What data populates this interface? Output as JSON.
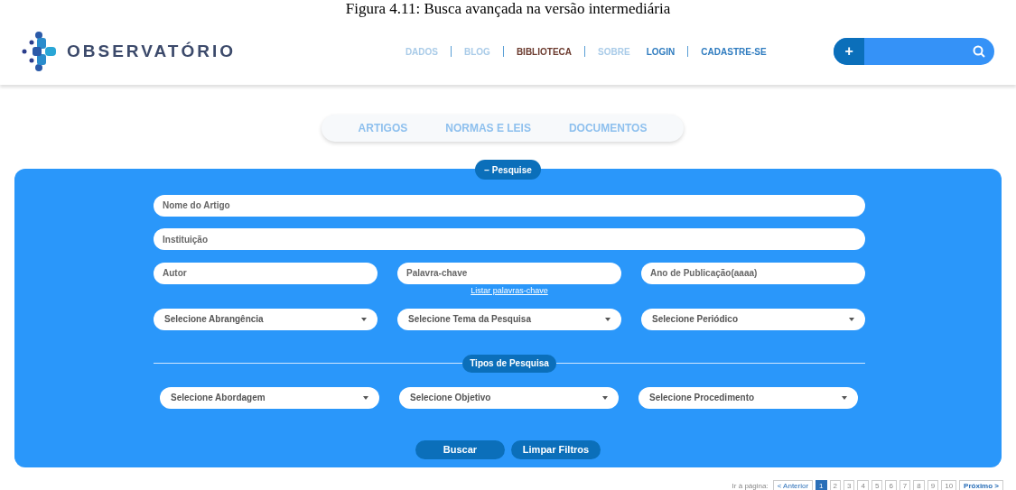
{
  "caption": "Figura 4.11: Busca avançada na versão intermediária",
  "logo": {
    "text": "OBSERVATÓRIO"
  },
  "nav": [
    {
      "label": "DADOS",
      "selected": false
    },
    {
      "label": "BLOG",
      "selected": false
    },
    {
      "label": "BIBLIOTECA",
      "selected": true
    },
    {
      "label": "SOBRE",
      "selected": false
    }
  ],
  "account": [
    "LOGIN",
    "CADASTRE-SE"
  ],
  "search": {
    "button": "+"
  },
  "tabs": [
    "ARTIGOS",
    "NORMAS E LEIS",
    "DOCUMENTOS"
  ],
  "panel": {
    "toggle": "− Pesquise",
    "rows": [
      [
        {
          "kind": "input",
          "placeholder": "Nome do Artigo"
        }
      ],
      [
        {
          "kind": "input",
          "placeholder": "Instituição"
        }
      ],
      [
        {
          "kind": "input",
          "placeholder": "Autor"
        },
        {
          "kind": "input",
          "placeholder": "Palavra-chave",
          "link": "Listar palavras-chave"
        },
        {
          "kind": "input",
          "placeholder": "Ano de Publicação(aaaa)"
        }
      ],
      [
        {
          "kind": "select",
          "value": "Selecione Abrangência"
        },
        {
          "kind": "select",
          "value": "Selecione Tema da Pesquisa"
        },
        {
          "kind": "select",
          "value": "Selecione Periódico"
        }
      ]
    ],
    "section": "Tipos de Pesquisa",
    "types": [
      {
        "kind": "select",
        "value": "Selecione Abordagem"
      },
      {
        "kind": "select",
        "value": "Selecione Objetivo"
      },
      {
        "kind": "select",
        "value": "Selecione Procedimento"
      }
    ],
    "buttons": [
      "Buscar",
      "Limpar Filtros"
    ]
  },
  "pagination": {
    "label": "Ir à página:",
    "prev": "< Anterior",
    "next": "Próximo >",
    "pages": [
      {
        "label": "1",
        "selected": true
      },
      {
        "label": "2",
        "selected": false
      },
      {
        "label": "3",
        "selected": false
      },
      {
        "label": "4",
        "selected": false
      },
      {
        "label": "5",
        "selected": false
      },
      {
        "label": "6",
        "selected": false
      },
      {
        "label": "7",
        "selected": false
      },
      {
        "label": "8",
        "selected": false
      },
      {
        "label": "9",
        "selected": false
      },
      {
        "label": "10",
        "selected": false
      }
    ]
  }
}
